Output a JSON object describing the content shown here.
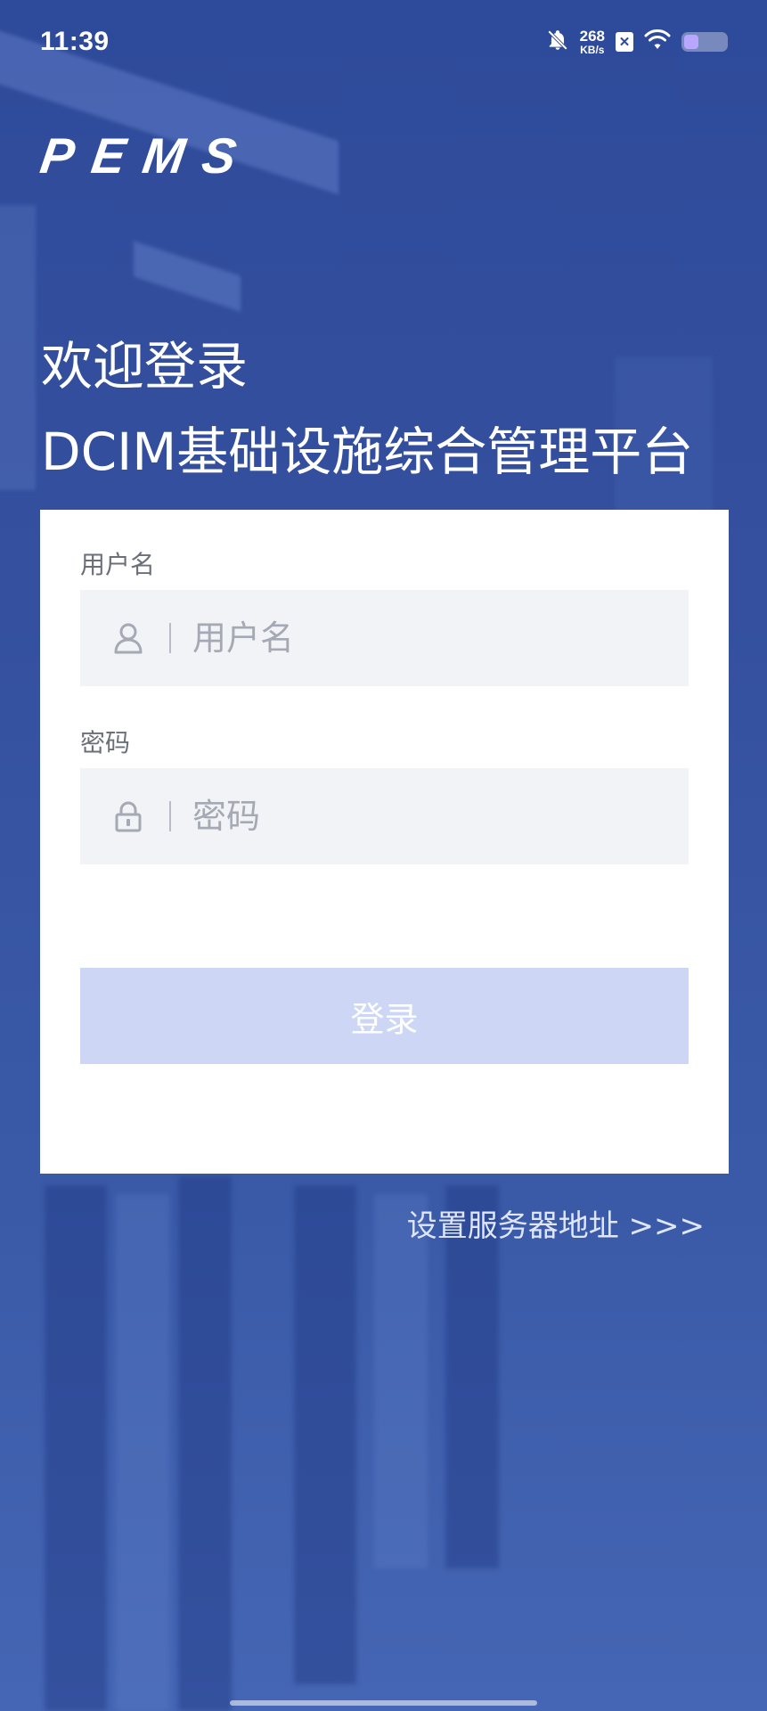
{
  "status_bar": {
    "time": "11:39",
    "net_speed_value": "268",
    "net_speed_unit": "KB/s",
    "sim_badge": "✕",
    "icons": [
      "bell-off-icon",
      "sim-off-icon",
      "wifi-icon",
      "battery-icon"
    ],
    "battery_level": 0.35
  },
  "brand": {
    "logo": "PEMS"
  },
  "hero": {
    "welcome": "欢迎登录",
    "platform_title": "DCIM基础设施综合管理平台"
  },
  "login_form": {
    "username_label": "用户名",
    "username_placeholder": "用户名",
    "username_value": "",
    "password_label": "密码",
    "password_placeholder": "密码",
    "password_value": "",
    "submit_label": "登录",
    "icons": [
      "user-icon",
      "lock-icon"
    ]
  },
  "links": {
    "server_settings": "设置服务器地址 >>>"
  },
  "colors": {
    "background": "#34509e",
    "card": "#ffffff",
    "field_bg": "#f2f3f6",
    "button_disabled": "#cdd7f5",
    "label_text": "#6b6f78",
    "placeholder_text": "#a4a9b4",
    "link_text": "#dfe6fb"
  }
}
